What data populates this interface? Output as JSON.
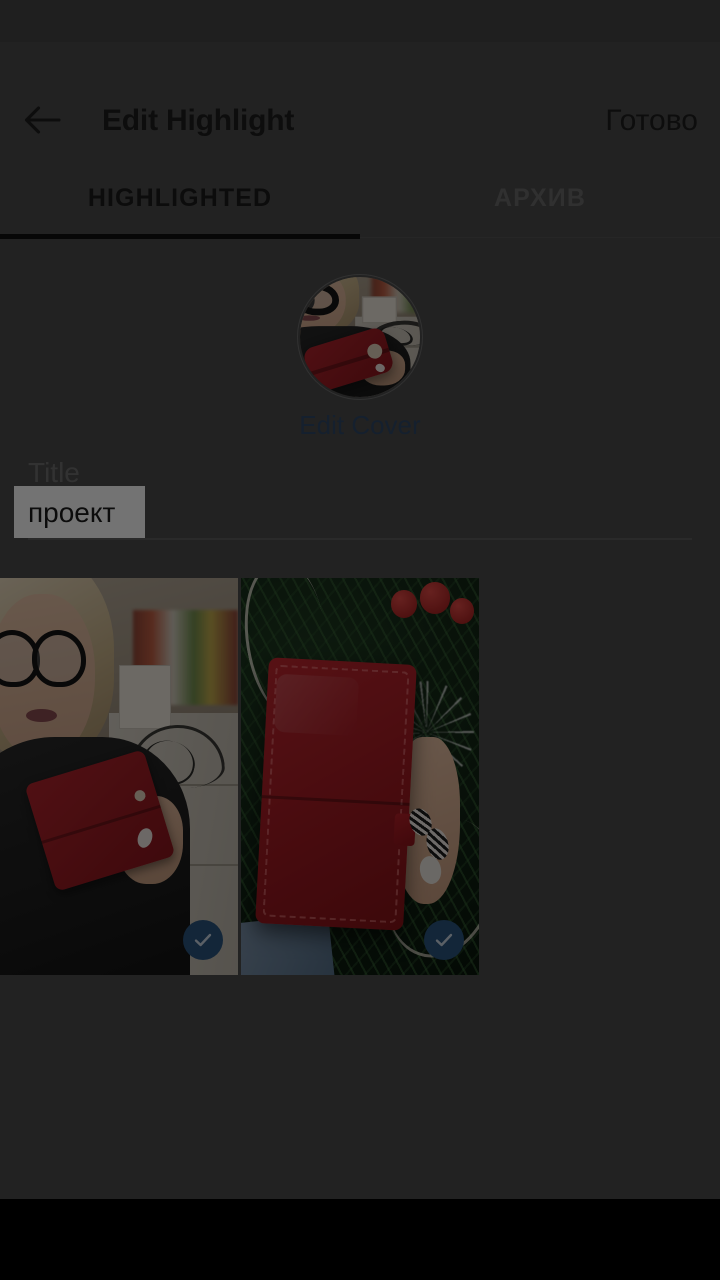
{
  "app": {
    "platform": "android",
    "screen_name": "Edit Highlight"
  },
  "action_bar": {
    "back_icon": "back-arrow-icon",
    "title": "Edit Highlight",
    "done_label": "Готово"
  },
  "tabs": {
    "active_index": 0,
    "items": [
      {
        "label": "HIGHLIGHTED",
        "active": true
      },
      {
        "label": "АРХИВ",
        "active": false
      }
    ]
  },
  "cover": {
    "edit_cover_label": "Edit Cover",
    "thumbnail_alt": "woman holding red leather wallet",
    "link_color": "#2f4867"
  },
  "title_field": {
    "label": "Title",
    "value": "проект",
    "placeholder": "Title",
    "selected": true,
    "selection_background": "#ffffff"
  },
  "story_grid": {
    "columns": 2,
    "items": [
      {
        "alt": "woman in glasses holding red wallet in room",
        "selected": true,
        "badge_icon": "check-icon"
      },
      {
        "alt": "red leather wallet held in hand by christmas tree",
        "selected": true,
        "badge_icon": "check-icon"
      }
    ]
  },
  "theme": {
    "status_bar_bg": "#464646",
    "app_bg": "#4c4c4c",
    "nav_bar_bg": "#000000",
    "text_primary": "#1d1d1d",
    "text_muted": "#6f6f6f",
    "tab_inactive": "#6b6b6b",
    "tab_indicator": "#111111",
    "select_badge_bg": "#2b567f",
    "scrim": "rgba(0,0,0,0.55)"
  }
}
